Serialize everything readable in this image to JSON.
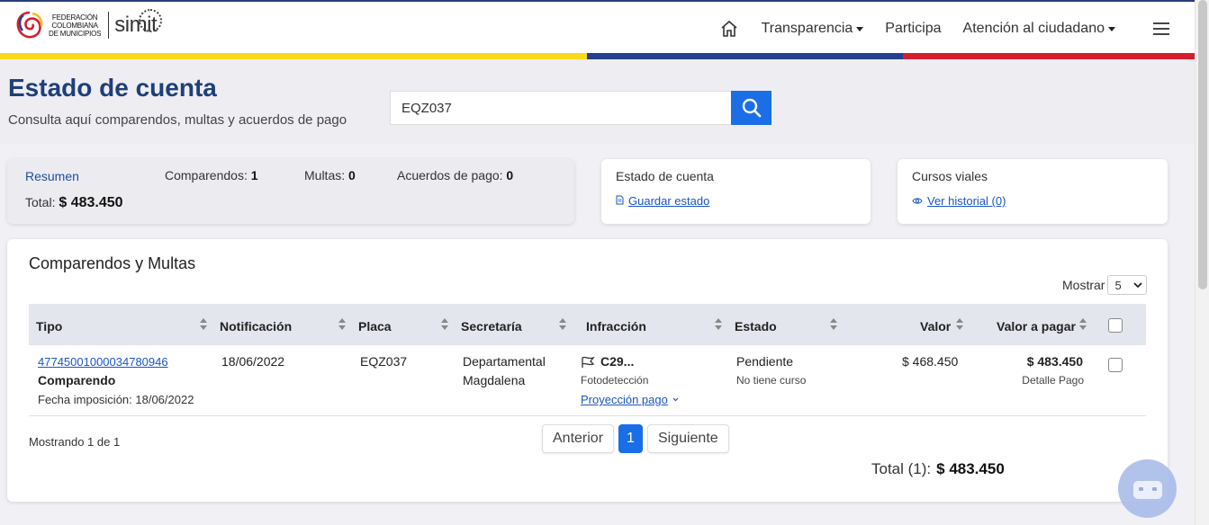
{
  "header": {
    "logo_fed": [
      "FEDERACIÓN",
      "COLOMBIANA",
      "DE MUNICIPIOS"
    ],
    "logo_simit": "simit",
    "nav": {
      "transparencia": "Transparencia",
      "participa": "Participa",
      "atencion": "Atención al ciudadano"
    },
    "stripe_colors": [
      "#f8d91c",
      "#253f8f",
      "#d4202e"
    ]
  },
  "page": {
    "title": "Estado de cuenta",
    "subtitle": "Consulta aquí comparendos, multas y acuerdos de pago",
    "search_value": "EQZ037"
  },
  "summary": {
    "resumen": "Resumen",
    "comparendos_label": "Comparendos:",
    "comparendos_value": "1",
    "multas_label": "Multas:",
    "multas_value": "0",
    "acuerdos_label": "Acuerdos de pago:",
    "acuerdos_value": "0",
    "total_label": "Total:",
    "total_value": "$ 483.450"
  },
  "estado_card": {
    "title": "Estado de cuenta",
    "link": "Guardar estado"
  },
  "cursos_card": {
    "title": "Cursos viales",
    "link": "Ver historial (0)"
  },
  "table": {
    "title": "Comparendos y Multas",
    "mostrar_label": "Mostrar",
    "mostrar_value": "5",
    "headers": {
      "tipo": "Tipo",
      "notificacion": "Notificación",
      "placa": "Placa",
      "secretaria": "Secretaría",
      "infraccion": "Infracción",
      "estado": "Estado",
      "valor": "Valor",
      "valor_pagar": "Valor a pagar"
    },
    "rows": [
      {
        "numero": "47745001000034780946",
        "tipo": "Comparendo",
        "fecha_imposicion": "Fecha imposición: 18/06/2022",
        "notificacion": "18/06/2022",
        "placa": "EQZ037",
        "secretaria_1": "Departamental",
        "secretaria_2": "Magdalena",
        "infraccion_code": "C29...",
        "infraccion_sub": "Fotodetección",
        "proyeccion": "Proyección pago",
        "estado": "Pendiente",
        "curso": "No tiene curso",
        "valor": "$ 468.450",
        "valor_pagar": "$ 483.450",
        "detalle": "Detalle Pago"
      }
    ],
    "mostrando": "Mostrando 1 de 1",
    "pager": {
      "prev": "Anterior",
      "page": "1",
      "next": "Siguiente"
    },
    "total_label": "Total (1):",
    "total_value": "$ 483.450"
  }
}
